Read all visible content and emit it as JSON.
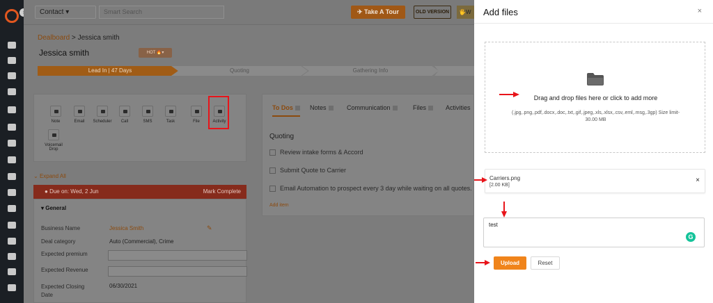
{
  "topbar": {
    "contact_select": "Contact",
    "search_placeholder": "Smart Search",
    "tour_button": "Take A Tour",
    "old_version_button": "OLD VERSION",
    "right_tab": "W"
  },
  "breadcrumb": {
    "link": "Dealboard",
    "separator": " > ",
    "current": "Jessica smith"
  },
  "contact_name": "Jessica smith",
  "hot_badge": "HOT",
  "pipeline": [
    "Lead In | 47 Days",
    "Quoting",
    "Gathering Info"
  ],
  "actions": [
    "Note",
    "Email",
    "Scheduler",
    "Call",
    "SMS",
    "Task",
    "File",
    "Activity",
    "Voicemail Drop"
  ],
  "expand_all": "Expand All",
  "due_bar": {
    "due": "Due on: Wed, 2 Jun",
    "mark_complete": "Mark Complete"
  },
  "general": {
    "title": "General",
    "fields": [
      {
        "label": "Business Name",
        "value": "Jessica Smith"
      },
      {
        "label": "Deal category",
        "value": "Auto (Commercial), Crime"
      },
      {
        "label": "Expected premium",
        "value": ""
      },
      {
        "label": "Expected Revenue",
        "value": ""
      },
      {
        "label": "Expected Closing Date",
        "value": "06/30/2021"
      }
    ]
  },
  "todo_panel": {
    "tabs": [
      "To Dos",
      "Notes",
      "Communication",
      "Files",
      "Activities"
    ],
    "section_title": "Quoting",
    "items": [
      "Review intake forms & Accord",
      "Submit Quote to Carrier",
      "Email Automation to prospect every 3 day while waiting on all quotes."
    ],
    "add_item": "Add item"
  },
  "modal": {
    "title": "Add files",
    "close": "×",
    "dropzone_text": "Drag and drop files here or click to add more",
    "dropzone_subtext": "(.jpg,.png,.pdf,.docx,.doc,.txt,.gif,.jpeg,.xls,.xlsx,.csv,.eml,.msg,.3gp) Size limit- 30.00 MB",
    "file": {
      "name": "Carriers.png",
      "size": "[2.00 KB]",
      "remove": "×"
    },
    "note_value": "test",
    "upload_button": "Upload",
    "reset_button": "Reset"
  },
  "colors": {
    "accent": "#f0841b",
    "arrow": "#e8141a",
    "sidebar": "#1b1f24"
  }
}
